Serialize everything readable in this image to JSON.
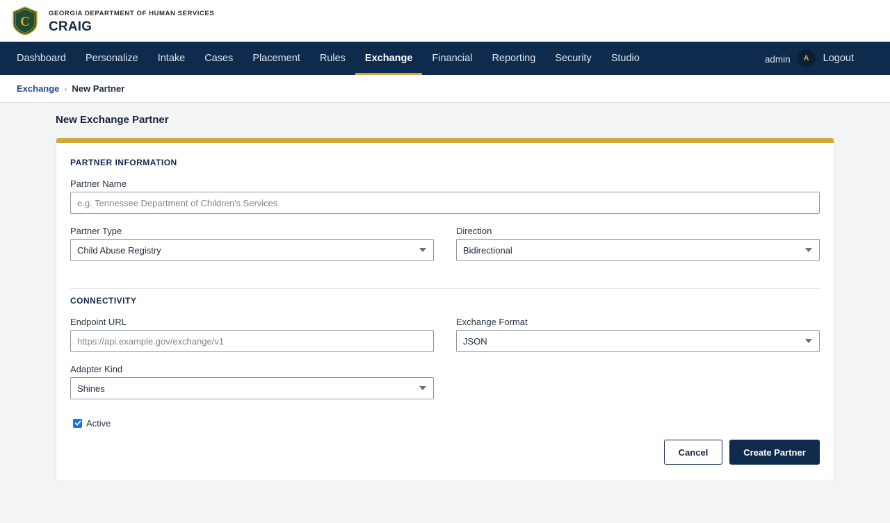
{
  "header": {
    "dept": "GEORGIA DEPARTMENT OF HUMAN SERVICES",
    "app": "CRAIG",
    "seal_letter": "C",
    "seal_color": "#1f4d2e",
    "seal_accent": "#d1a83e"
  },
  "nav": {
    "items": [
      {
        "label": "Dashboard"
      },
      {
        "label": "Personalize"
      },
      {
        "label": "Intake"
      },
      {
        "label": "Cases"
      },
      {
        "label": "Placement"
      },
      {
        "label": "Rules"
      },
      {
        "label": "Exchange",
        "active": true
      },
      {
        "label": "Financial"
      },
      {
        "label": "Reporting"
      },
      {
        "label": "Security"
      },
      {
        "label": "Studio"
      }
    ],
    "user": "admin",
    "avatar_initial": "A",
    "logout": "Logout"
  },
  "breadcrumb": {
    "parent": "Exchange",
    "separator": "›",
    "current": "New Partner"
  },
  "page": {
    "title": "New Exchange Partner"
  },
  "form": {
    "partner_section": "PARTNER INFORMATION",
    "partner_name": {
      "label": "Partner Name",
      "value": "",
      "placeholder": "e.g. Tennessee Department of Children's Services"
    },
    "partner_type": {
      "label": "Partner Type",
      "value": "Child Abuse Registry"
    },
    "direction": {
      "label": "Direction",
      "value": "Bidirectional"
    },
    "connectivity_section": "CONNECTIVITY",
    "endpoint_url": {
      "label": "Endpoint URL",
      "value": "",
      "placeholder": "https://api.example.gov/exchange/v1"
    },
    "exchange_format": {
      "label": "Exchange Format",
      "value": "JSON"
    },
    "adapter_kind": {
      "label": "Adapter Kind",
      "value": "Shines"
    },
    "active": {
      "label": "Active",
      "checked": true
    },
    "cancel_label": "Cancel",
    "create_label": "Create Partner"
  },
  "colors": {
    "nav_bg": "#0e2a4d",
    "accent": "#d1a83e",
    "link": "#1e4a86",
    "checkbox": "#1a73e8"
  }
}
